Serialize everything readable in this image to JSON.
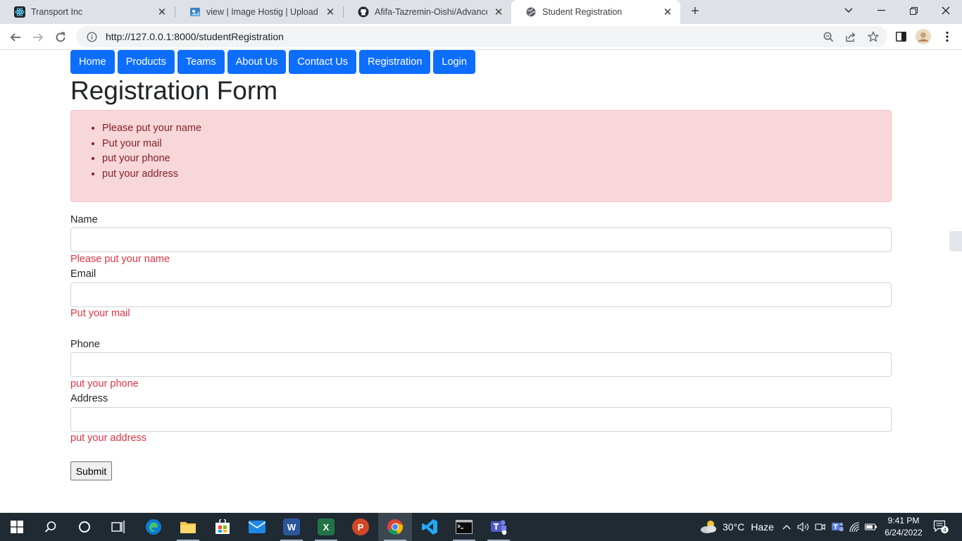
{
  "browser": {
    "tabs": [
      {
        "title": "Transport Inc",
        "icon": "react-icon"
      },
      {
        "title": "view | Image Hostig | Upload Ima",
        "icon": "image-host-icon"
      },
      {
        "title": "Afifa-Tazremin-Oishi/Advance-W",
        "icon": "github-icon"
      },
      {
        "title": "Student Registration",
        "icon": "globe-icon",
        "active": true
      }
    ],
    "url": "http://127.0.0.1:8000/studentRegistration"
  },
  "nav": {
    "items": [
      "Home",
      "Products",
      "Teams",
      "About Us",
      "Contact Us",
      "Registration",
      "Login"
    ],
    "color": "#0d6efd"
  },
  "form": {
    "title": "Registration Form",
    "alert_errors": [
      "Please put your name",
      "Put your mail",
      "put your phone",
      "put your address"
    ],
    "fields": [
      {
        "label": "Name",
        "value": "",
        "error": "Please put your name"
      },
      {
        "label": "Email",
        "value": "",
        "error": "Put your mail"
      },
      {
        "label": "Phone",
        "value": "",
        "error": "put your phone"
      },
      {
        "label": "Address",
        "value": "",
        "error": "put your address"
      }
    ],
    "submit_label": "Submit",
    "error_color": "#dc3545"
  },
  "taskbar": {
    "weather_temp": "30°C",
    "weather_desc": "Haze",
    "time": "9:41 PM",
    "date": "6/24/2022",
    "notification_count": "4"
  }
}
